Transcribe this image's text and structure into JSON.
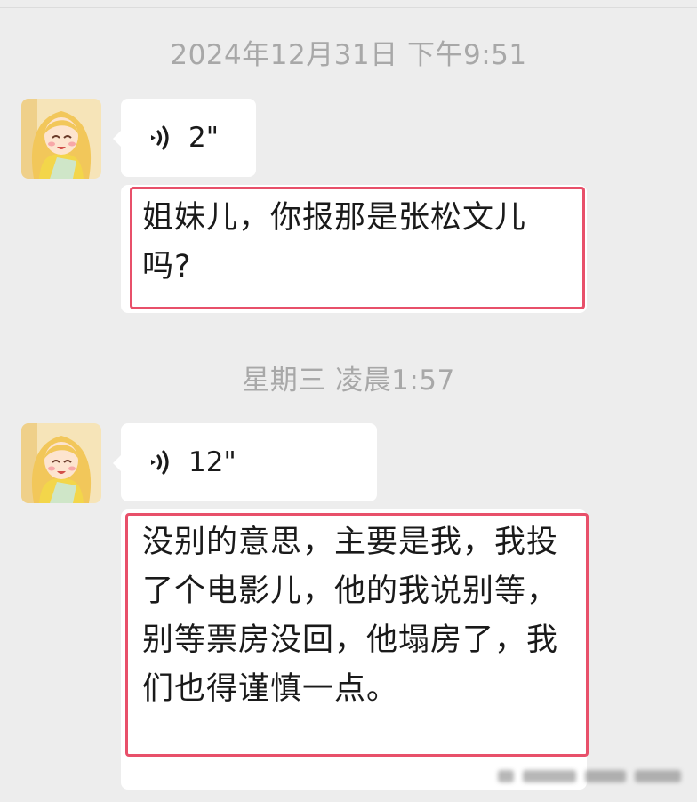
{
  "chat": {
    "timestamps": [
      "2024年12月31日 下午9:51",
      "星期三 凌晨1:57"
    ],
    "messages": [
      {
        "type": "voice",
        "icon": "voice-wave-icon",
        "duration": "2\""
      },
      {
        "type": "text",
        "text": "姐妹儿，你报那是张松文儿吗?",
        "highlighted": true
      },
      {
        "type": "voice",
        "icon": "voice-wave-icon",
        "duration": "12\""
      },
      {
        "type": "text",
        "text": "没别的意思，主要是我，我投了个电影儿，他的我说别等，别等票房没回，他塌房了，我们也得谨慎一点。",
        "highlighted": true
      }
    ]
  },
  "colors": {
    "background": "#ededed",
    "bubble": "#ffffff",
    "timestamp_text": "#a8a8a8",
    "highlight_border": "#e8506a"
  }
}
